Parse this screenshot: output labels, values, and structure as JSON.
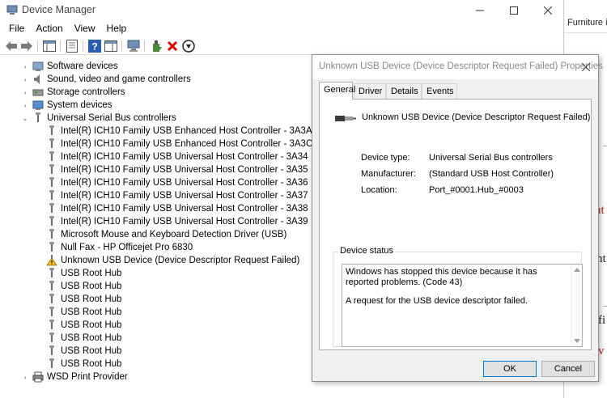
{
  "device_manager": {
    "title": "Device Manager",
    "menu": [
      "File",
      "Action",
      "View",
      "Help"
    ],
    "tree": [
      {
        "label": "Software devices",
        "expander": "›",
        "level": "category",
        "icon": "software-devices-icon"
      },
      {
        "label": "Sound, video and game controllers",
        "expander": "›",
        "level": "category",
        "icon": "speaker-icon"
      },
      {
        "label": "Storage controllers",
        "expander": "›",
        "level": "category",
        "icon": "storage-icon"
      },
      {
        "label": "System devices",
        "expander": "›",
        "level": "category",
        "icon": "system-devices-icon"
      },
      {
        "label": "Universal Serial Bus controllers",
        "expander": "⌄",
        "level": "category",
        "icon": "usb-icon"
      },
      {
        "label": "Intel(R) ICH10 Family USB Enhanced Host Controller - 3A3A",
        "level": "device",
        "icon": "usb-icon"
      },
      {
        "label": "Intel(R) ICH10 Family USB Enhanced Host Controller - 3A3C",
        "level": "device",
        "icon": "usb-icon"
      },
      {
        "label": "Intel(R) ICH10 Family USB Universal Host Controller - 3A34",
        "level": "device",
        "icon": "usb-icon"
      },
      {
        "label": "Intel(R) ICH10 Family USB Universal Host Controller - 3A35",
        "level": "device",
        "icon": "usb-icon"
      },
      {
        "label": "Intel(R) ICH10 Family USB Universal Host Controller - 3A36",
        "level": "device",
        "icon": "usb-icon"
      },
      {
        "label": "Intel(R) ICH10 Family USB Universal Host Controller - 3A37",
        "level": "device",
        "icon": "usb-icon"
      },
      {
        "label": "Intel(R) ICH10 Family USB Universal Host Controller - 3A38",
        "level": "device",
        "icon": "usb-icon"
      },
      {
        "label": "Intel(R) ICH10 Family USB Universal Host Controller - 3A39",
        "level": "device",
        "icon": "usb-icon"
      },
      {
        "label": "Microsoft Mouse and Keyboard Detection Driver (USB)",
        "level": "device",
        "icon": "usb-icon"
      },
      {
        "label": "Null Fax - HP Officejet Pro 6830",
        "level": "device",
        "icon": "usb-icon"
      },
      {
        "label": "Unknown USB Device (Device Descriptor Request Failed)",
        "level": "device",
        "icon": "warning-icon"
      },
      {
        "label": "USB Root Hub",
        "level": "device",
        "icon": "usb-icon"
      },
      {
        "label": "USB Root Hub",
        "level": "device",
        "icon": "usb-icon"
      },
      {
        "label": "USB Root Hub",
        "level": "device",
        "icon": "usb-icon"
      },
      {
        "label": "USB Root Hub",
        "level": "device",
        "icon": "usb-icon"
      },
      {
        "label": "USB Root Hub",
        "level": "device",
        "icon": "usb-icon"
      },
      {
        "label": "USB Root Hub",
        "level": "device",
        "icon": "usb-icon"
      },
      {
        "label": "USB Root Hub",
        "level": "device",
        "icon": "usb-icon"
      },
      {
        "label": "USB Root Hub",
        "level": "device",
        "icon": "usb-icon"
      },
      {
        "label": "WSD Print Provider",
        "expander": "›",
        "level": "category",
        "icon": "printer-icon"
      }
    ]
  },
  "background_window": {
    "text": "Furniture in",
    "fragments": [
      "ut",
      "nt",
      "fi",
      "v"
    ]
  },
  "dialog": {
    "title": "Unknown USB Device (Device Descriptor Request Failed) Properties",
    "tabs": [
      "General",
      "Driver",
      "Details",
      "Events"
    ],
    "device_name": "Unknown USB Device (Device Descriptor Request Failed)",
    "properties": [
      {
        "label": "Device type:",
        "value": "Universal Serial Bus controllers"
      },
      {
        "label": "Manufacturer:",
        "value": "(Standard USB Host Controller)"
      },
      {
        "label": "Location:",
        "value": "Port_#0001.Hub_#0003"
      }
    ],
    "status_legend": "Device status",
    "status_line1": "Windows has stopped this device because it has reported problems. (Code 43)",
    "status_line2": "A request for the USB device descriptor failed.",
    "ok_label": "OK",
    "cancel_label": "Cancel"
  },
  "colors": {
    "error_red": "#d40000",
    "dialog_bg": "#f0f0f0",
    "accent_blue": "#0078d7",
    "warning_yellow": "#f5c400"
  }
}
